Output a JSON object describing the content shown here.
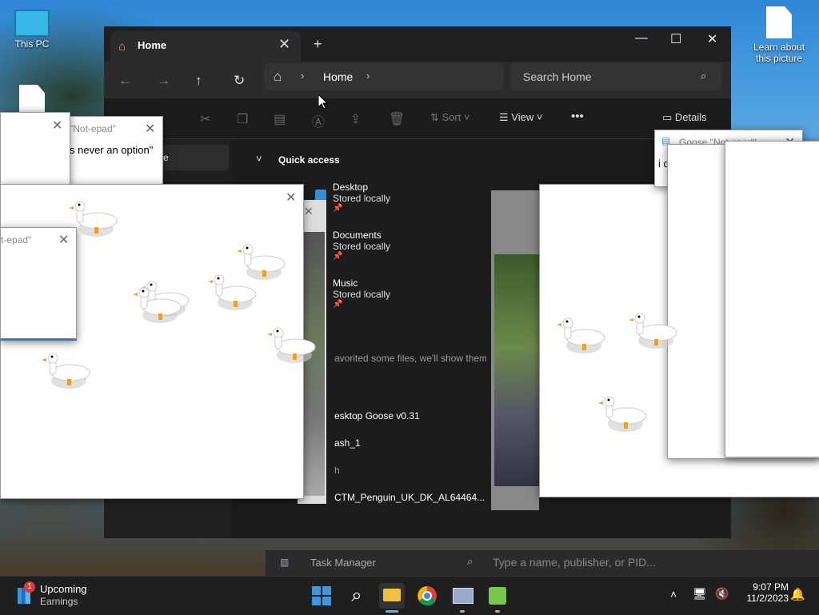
{
  "desktop": {
    "icon_this_pc": "This PC",
    "icon_learn": "Learn about this picture"
  },
  "explorer": {
    "tab_title": "Home",
    "tab_close": "✕",
    "new_tab": "+",
    "minimize": "—",
    "maximize": "☐",
    "close": "✕",
    "address_home": "Home",
    "search_placeholder": "Search Home",
    "sort_label": "Sort",
    "view_label": "View",
    "more_label": "•••",
    "details_label": "Details",
    "sidebar_item": "me",
    "quick_access": "Quick access",
    "quick_items": [
      {
        "name": "Desktop",
        "sub": "Stored locally",
        "color": "#2f8fd8"
      },
      {
        "name": "Documents",
        "sub": "Stored locally",
        "color": "#6f8fa8"
      },
      {
        "name": "Music",
        "sub": "Stored locally",
        "color": "#d04a5a"
      }
    ],
    "favorites_text": "avorited some files, we'll show them",
    "recent_files": [
      "esktop Goose v0.31",
      "ash_1",
      "h",
      "CTM_Penguin_UK_DK_AL64464..."
    ]
  },
  "goose_windows": {
    "notepad_title_1": "\"Not-epad\"",
    "notepad_text_1": "s never an option\"",
    "notepad_title_2": "t-epad\"",
    "notepad_title_3": "Goose \"Not-epad\"",
    "notepad_text_3": "i c"
  },
  "taskmgr": {
    "title": "Task Manager",
    "search_placeholder": "Type a name, publisher, or PID..."
  },
  "taskbar": {
    "widget_badge": "1",
    "widget_title": "Upcoming",
    "widget_sub": "Earnings",
    "time": "9:07 PM",
    "date": "11/2/2023",
    "colors": {
      "accent": "#3a96dd",
      "active_indicator": "#5fb2f2"
    }
  }
}
